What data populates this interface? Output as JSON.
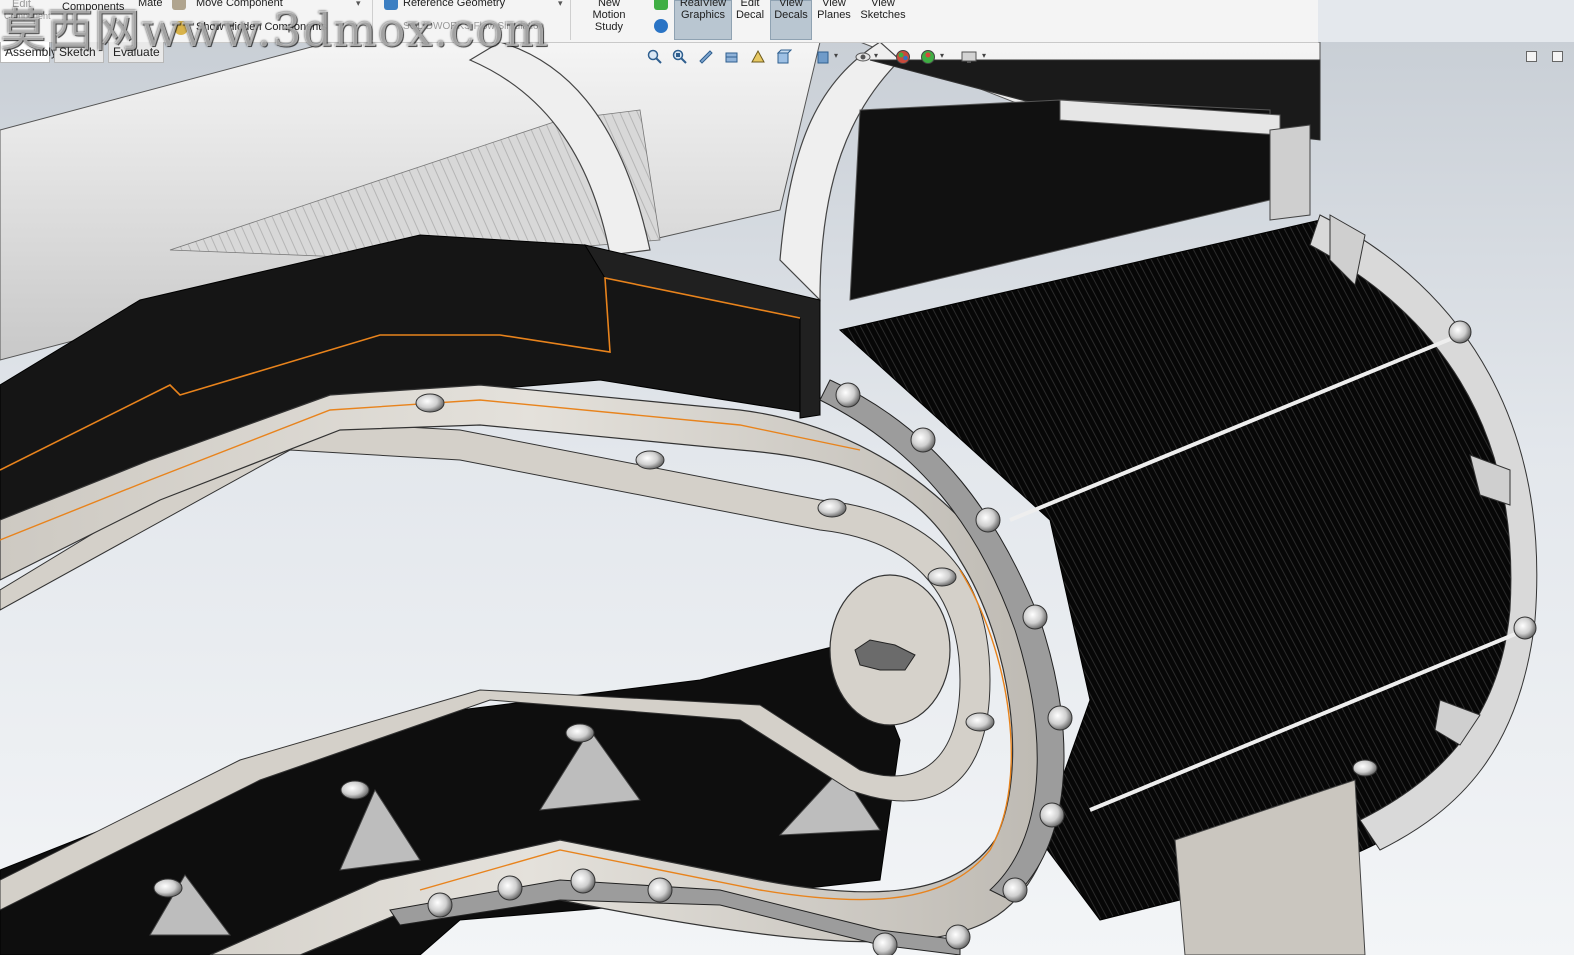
{
  "ribbon": {
    "edit_component_label": "Edit",
    "edit_component_sub": "Component",
    "components_label": "Components",
    "mate_label": "Mate",
    "move_component_label": "Move Component",
    "show_hidden_label": "Show Hidden Components",
    "reference_geometry_label": "Reference Geometry",
    "flow_simulation_label": "SOLIDWORKS Flow Simulation",
    "new_motion_study_label": [
      "New",
      "Motion",
      "Study"
    ],
    "realview_label": [
      "RealView",
      "Graphics"
    ],
    "edit_decal_label": [
      "Edit",
      "Decal"
    ],
    "view_decals_label": [
      "View",
      "Decals"
    ],
    "view_planes_label": [
      "View",
      "Planes"
    ],
    "view_sketches_label": [
      "View",
      "Sketches"
    ]
  },
  "tabs": [
    {
      "label": "Assembly",
      "active": true
    },
    {
      "label": "Sketch",
      "active": false
    },
    {
      "label": "Evaluate",
      "active": false
    }
  ],
  "heads_up_toolbar": [
    "zoom-to-fit-icon",
    "zoom-area-icon",
    "previous-view-icon",
    "section-view-icon",
    "dynamic-annotation-icon",
    "view-orientation-icon",
    "display-style-icon",
    "hide-show-icon",
    "edit-appearance-icon",
    "apply-scene-icon",
    "view-settings-icon"
  ],
  "watermark": "莫西网www.3dmox.com",
  "colors": {
    "selection_edge": "#e8831c",
    "body_dark": "#0c0c0c",
    "frame_light": "#dcdad5",
    "background_top": "#c9cfd6",
    "background_bottom": "#f3f5f7",
    "active_tile": "#b9c6d1"
  }
}
